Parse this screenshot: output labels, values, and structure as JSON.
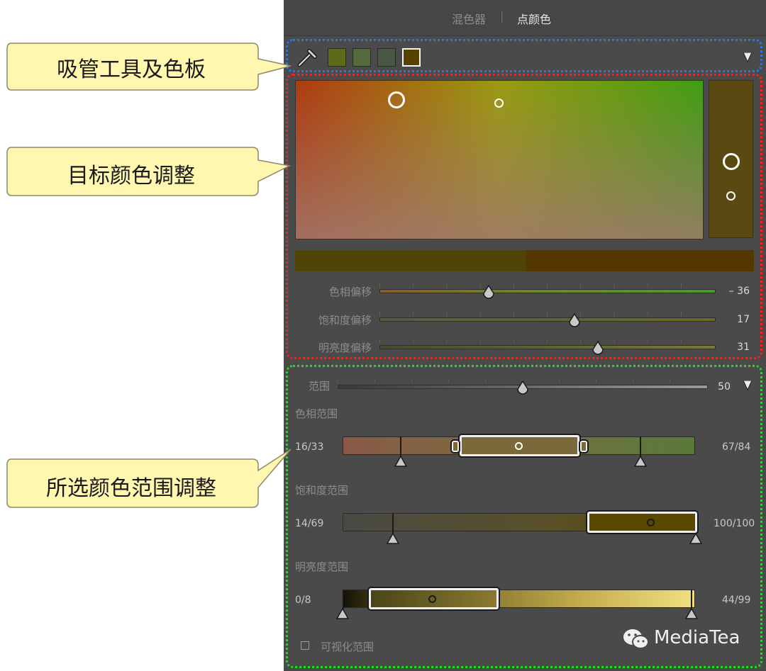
{
  "tabs": {
    "mixer": "混色器",
    "separator": "|",
    "point_color": "点颜色"
  },
  "callouts": {
    "eyedropper_and_swatches": "吸管工具及色板",
    "target_color_adjust": "目标颜色调整",
    "selected_range_adjust": "所选颜色范围调整"
  },
  "swatches": [
    "#5b6b1a",
    "#546a3c",
    "#485842",
    "#574300"
  ],
  "sliders": [
    {
      "label": "色相偏移",
      "value": "– 36",
      "fraction": 0.33
    },
    {
      "label": "饱和度偏移",
      "value": "17",
      "fraction": 0.58
    },
    {
      "label": "明亮度偏移",
      "value": "31",
      "fraction": 0.65
    }
  ],
  "range": {
    "label": "范围",
    "value": "50",
    "fraction": 0.5
  },
  "hue_range": {
    "label": "色相范围",
    "left": "16/33",
    "right": "67/84"
  },
  "sat_range": {
    "label": "饱和度范围",
    "left": "14/69",
    "right": "100/100"
  },
  "lum_range": {
    "label": "明亮度范围",
    "left": "0/8",
    "right": "44/99"
  },
  "visualize": {
    "label": "可视化范围"
  },
  "watermark": {
    "text": "MediaTea"
  },
  "colors": {
    "panel_bg": "#4a4a4a",
    "blue_dashed": "#1e78ff",
    "red_dashed": "#ff1e1e",
    "green_dashed": "#1edc1e",
    "callout_fill": "#fff6b0"
  }
}
